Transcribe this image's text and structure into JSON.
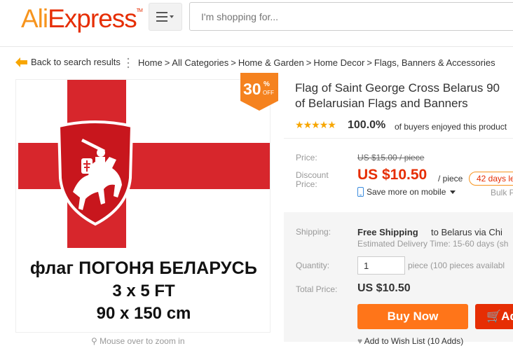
{
  "header": {
    "logo_ali": "Ali",
    "logo_express": "Express",
    "logo_tm": "TM",
    "search_placeholder": "I'm shopping for..."
  },
  "breadcrumb": {
    "back_label": "Back to search results",
    "items": [
      "Home",
      "All Categories",
      "Home & Garden",
      "Home Decor",
      "Flags, Banners & Accessories"
    ],
    "separator": ">"
  },
  "image": {
    "flag_text_line1": "флаг ПОГОНЯ БЕЛАРУСЬ",
    "flag_text_line2": "3 x 5 FT",
    "flag_text_line3": "90 x 150 cm",
    "discount_value": "30",
    "discount_percent": "%",
    "discount_off": "OFF",
    "zoom_hint": "Mouse over to zoom in"
  },
  "product": {
    "title_line1": "Flag of Saint George Cross Belarus 90",
    "title_line2": "of Belarusian Flags and Banners",
    "rating_percent": "100.0%",
    "rating_text": "of buyers enjoyed this product",
    "price_label": "Price:",
    "old_price": "US $15.00 / piece",
    "discount_price_label_1": "Discount",
    "discount_price_label_2": "Price:",
    "price": "US $10.50",
    "per_unit": "/ piece",
    "days_left": "42 days le",
    "mobile_savings": "Save more on mobile",
    "bulk": "Bulk P"
  },
  "shipping": {
    "label": "Shipping:",
    "free": "Free Shipping",
    "destination": "to  Belarus via Chi",
    "eta": "Estimated Delivery Time: 15-60 days (sh"
  },
  "quantity": {
    "label": "Quantity:",
    "value": "1",
    "note": "piece (100 pieces availabl"
  },
  "total": {
    "label": "Total Price:",
    "value": "US $10.50"
  },
  "actions": {
    "buy_now": "Buy Now",
    "add_to_cart": "Ad",
    "wishlist": "Add to Wish List (10 Adds)"
  },
  "colors": {
    "brand_orange": "#f7941d",
    "brand_red": "#e62e04",
    "buy_button": "#ff7519",
    "flag_red": "#d7262c"
  }
}
